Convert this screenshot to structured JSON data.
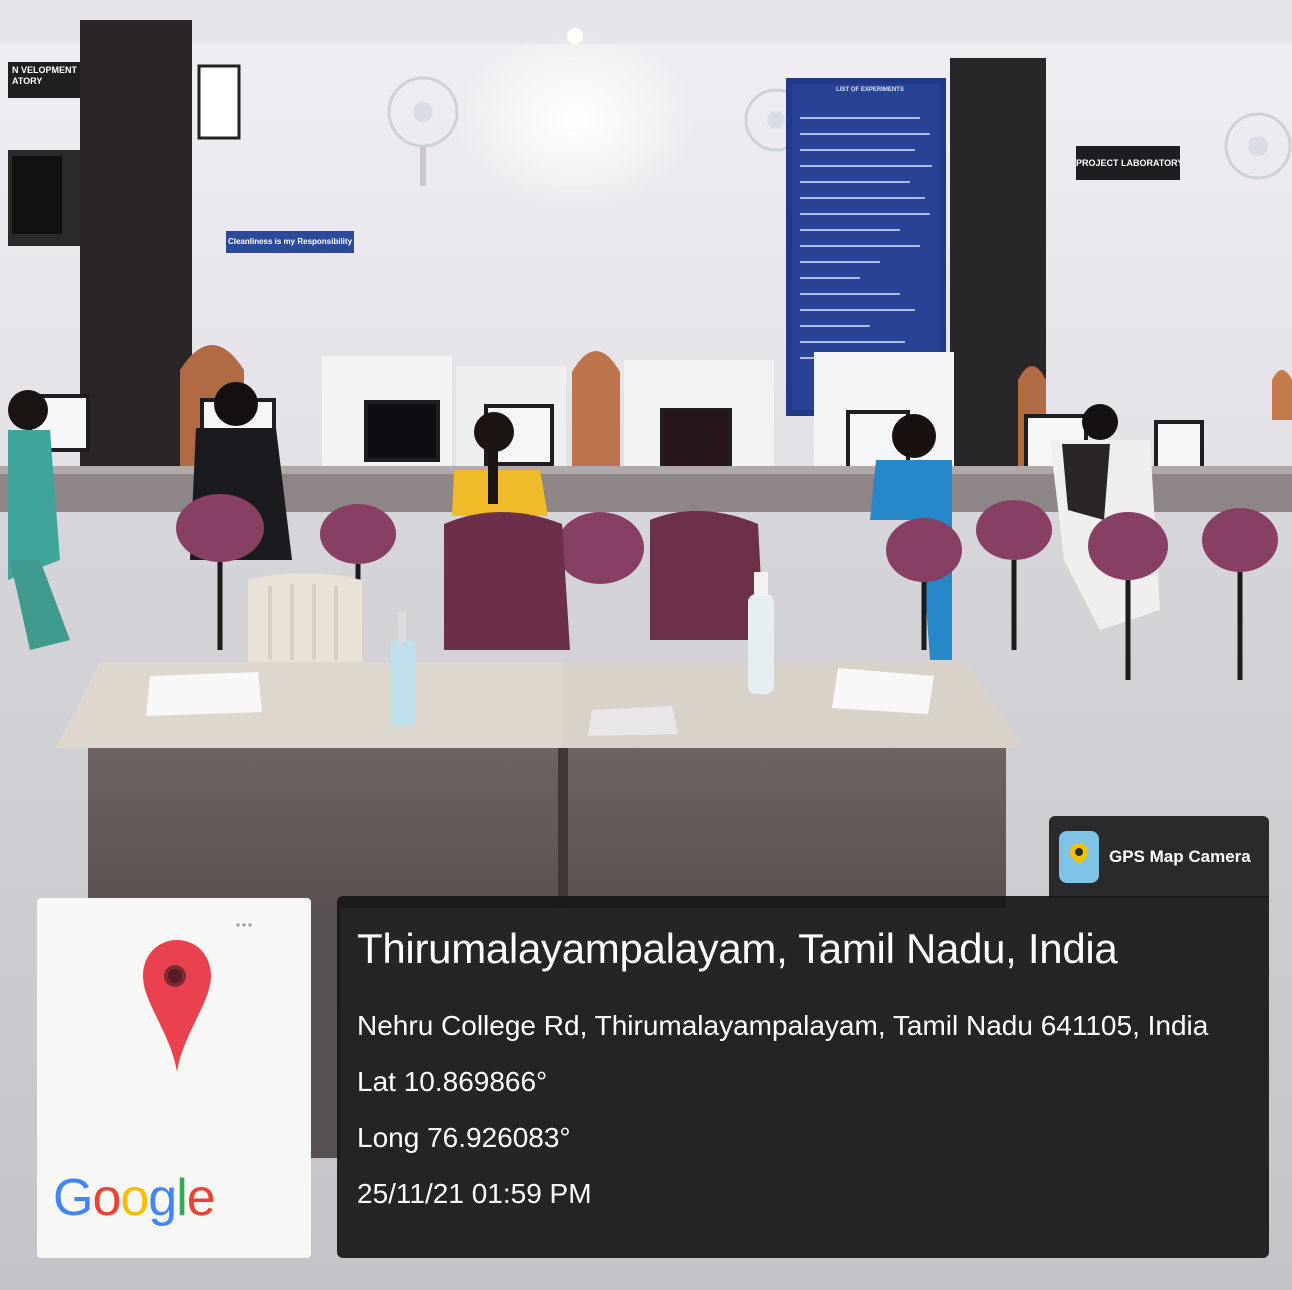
{
  "photo": {
    "wall_signs": {
      "development": "N VELOPMENT\nATORY",
      "cleanliness": "Cleanliness is my Responsibility",
      "project": "PROJECT LABORATORY"
    },
    "notice_board_heading": "LIST OF EXPERIMENTS"
  },
  "overlay": {
    "app_icon": "gps-map-camera-icon",
    "app_name": "GPS Map Camera",
    "location_title": "Thirumalayampalayam, Tamil Nadu, India",
    "address": "Nehru College Rd, Thirumalayampalayam, Tamil Nadu 641105, India",
    "latitude": "Lat 10.869866°",
    "longitude": "Long 76.926083°",
    "datetime": "25/11/21 01:59 PM",
    "map_pin_icon": "map-pin-icon",
    "map_logo": "Google",
    "map_logo_colors": [
      "#4285f4",
      "#ea4335",
      "#fbbc05",
      "#4285f4",
      "#34a853",
      "#ea4335"
    ]
  }
}
